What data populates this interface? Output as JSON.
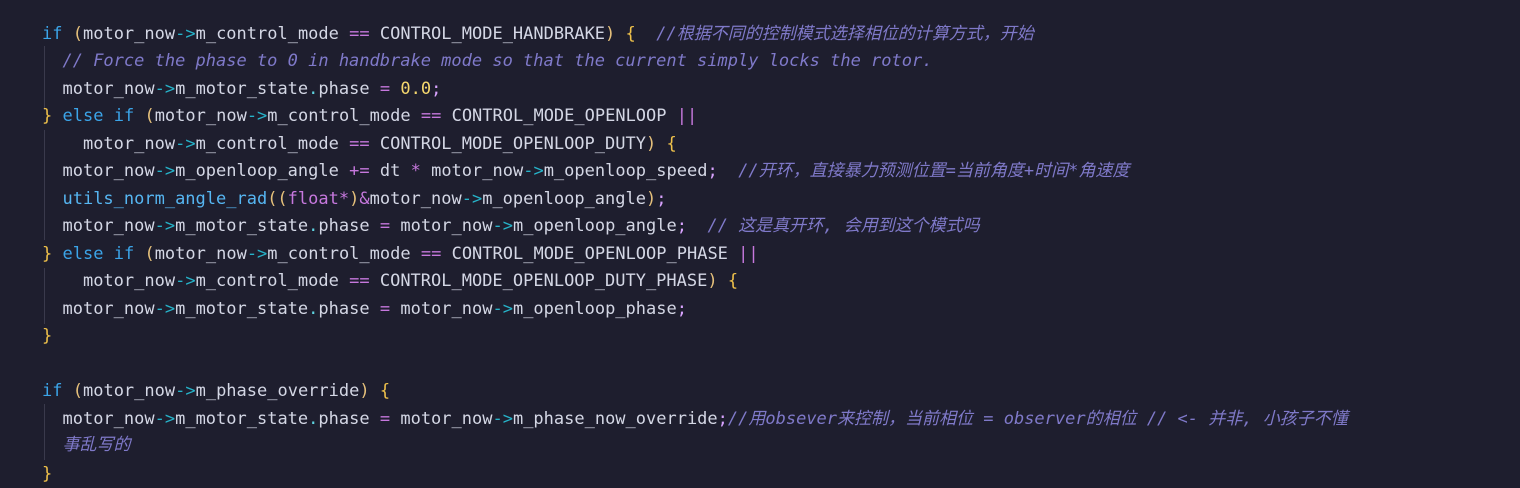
{
  "code": {
    "l1": {
      "kw": "if",
      "p1": "(",
      "a": "motor_now",
      "arrow": "->",
      "b": "m_control_mode",
      "op": "==",
      "c": "CONTROL_MODE_HANDBRAKE",
      "p2": ")",
      "brace": "{",
      "comment": "//根据不同的控制模式选择相位的计算方式，开始"
    },
    "l2": {
      "comment": "// Force the phase to 0 in handbrake mode so that the current simply locks the rotor."
    },
    "l3": {
      "a": "motor_now",
      "arrow": "->",
      "b": "m_motor_state",
      "dot": ".",
      "c": "phase",
      "op": "=",
      "num": "0.0",
      "semi": ";"
    },
    "l4": {
      "brace": "}",
      "kw1": "else",
      "kw2": "if",
      "p1": "(",
      "a": "motor_now",
      "arrow": "->",
      "b": "m_control_mode",
      "op": "==",
      "c": "CONTROL_MODE_OPENLOOP",
      "op2": "||"
    },
    "l5": {
      "a": "motor_now",
      "arrow": "->",
      "b": "m_control_mode",
      "op": "==",
      "c": "CONTROL_MODE_OPENLOOP_DUTY",
      "p2": ")",
      "brace": "{"
    },
    "l6": {
      "a": "motor_now",
      "arrow": "->",
      "b": "m_openloop_angle",
      "op": "+=",
      "c": "dt",
      "op2": "*",
      "d": "motor_now",
      "arrow2": "->",
      "e": "m_openloop_speed",
      "semi": ";",
      "comment": "//开环，直接暴力预测位置=当前角度+时间*角速度"
    },
    "l7": {
      "fn": "utils_norm_angle_rad",
      "p1": "((",
      "cast": "float*",
      "p2": ")",
      "amp": "&",
      "a": "motor_now",
      "arrow": "->",
      "b": "m_openloop_angle",
      "p3": ")",
      "semi": ";"
    },
    "l8": {
      "a": "motor_now",
      "arrow": "->",
      "b": "m_motor_state",
      "dot": ".",
      "c": "phase",
      "op": "=",
      "d": "motor_now",
      "arrow2": "->",
      "e": "m_openloop_angle",
      "semi": ";",
      "comment": "// 这是真开环, 会用到这个模式吗"
    },
    "l9": {
      "brace": "}",
      "kw1": "else",
      "kw2": "if",
      "p1": "(",
      "a": "motor_now",
      "arrow": "->",
      "b": "m_control_mode",
      "op": "==",
      "c": "CONTROL_MODE_OPENLOOP_PHASE",
      "op2": "||"
    },
    "l10": {
      "a": "motor_now",
      "arrow": "->",
      "b": "m_control_mode",
      "op": "==",
      "c": "CONTROL_MODE_OPENLOOP_DUTY_PHASE",
      "p2": ")",
      "brace": "{"
    },
    "l11": {
      "a": "motor_now",
      "arrow": "->",
      "b": "m_motor_state",
      "dot": ".",
      "c": "phase",
      "op": "=",
      "d": "motor_now",
      "arrow2": "->",
      "e": "m_openloop_phase",
      "semi": ";"
    },
    "l12": {
      "brace": "}"
    },
    "l14": {
      "kw": "if",
      "p1": "(",
      "a": "motor_now",
      "arrow": "->",
      "b": "m_phase_override",
      "p2": ")",
      "brace": "{"
    },
    "l15": {
      "a": "motor_now",
      "arrow": "->",
      "b": "m_motor_state",
      "dot": ".",
      "c": "phase",
      "op": "=",
      "d": "motor_now",
      "arrow2": "->",
      "e": "m_phase_now_override",
      "semi": ";",
      "comment": "//用obsever来控制，当前相位 = observer的相位 // <- 并非, 小孩子不懂"
    },
    "l15b": {
      "comment": "事乱写的"
    },
    "l16": {
      "brace": "}"
    }
  }
}
